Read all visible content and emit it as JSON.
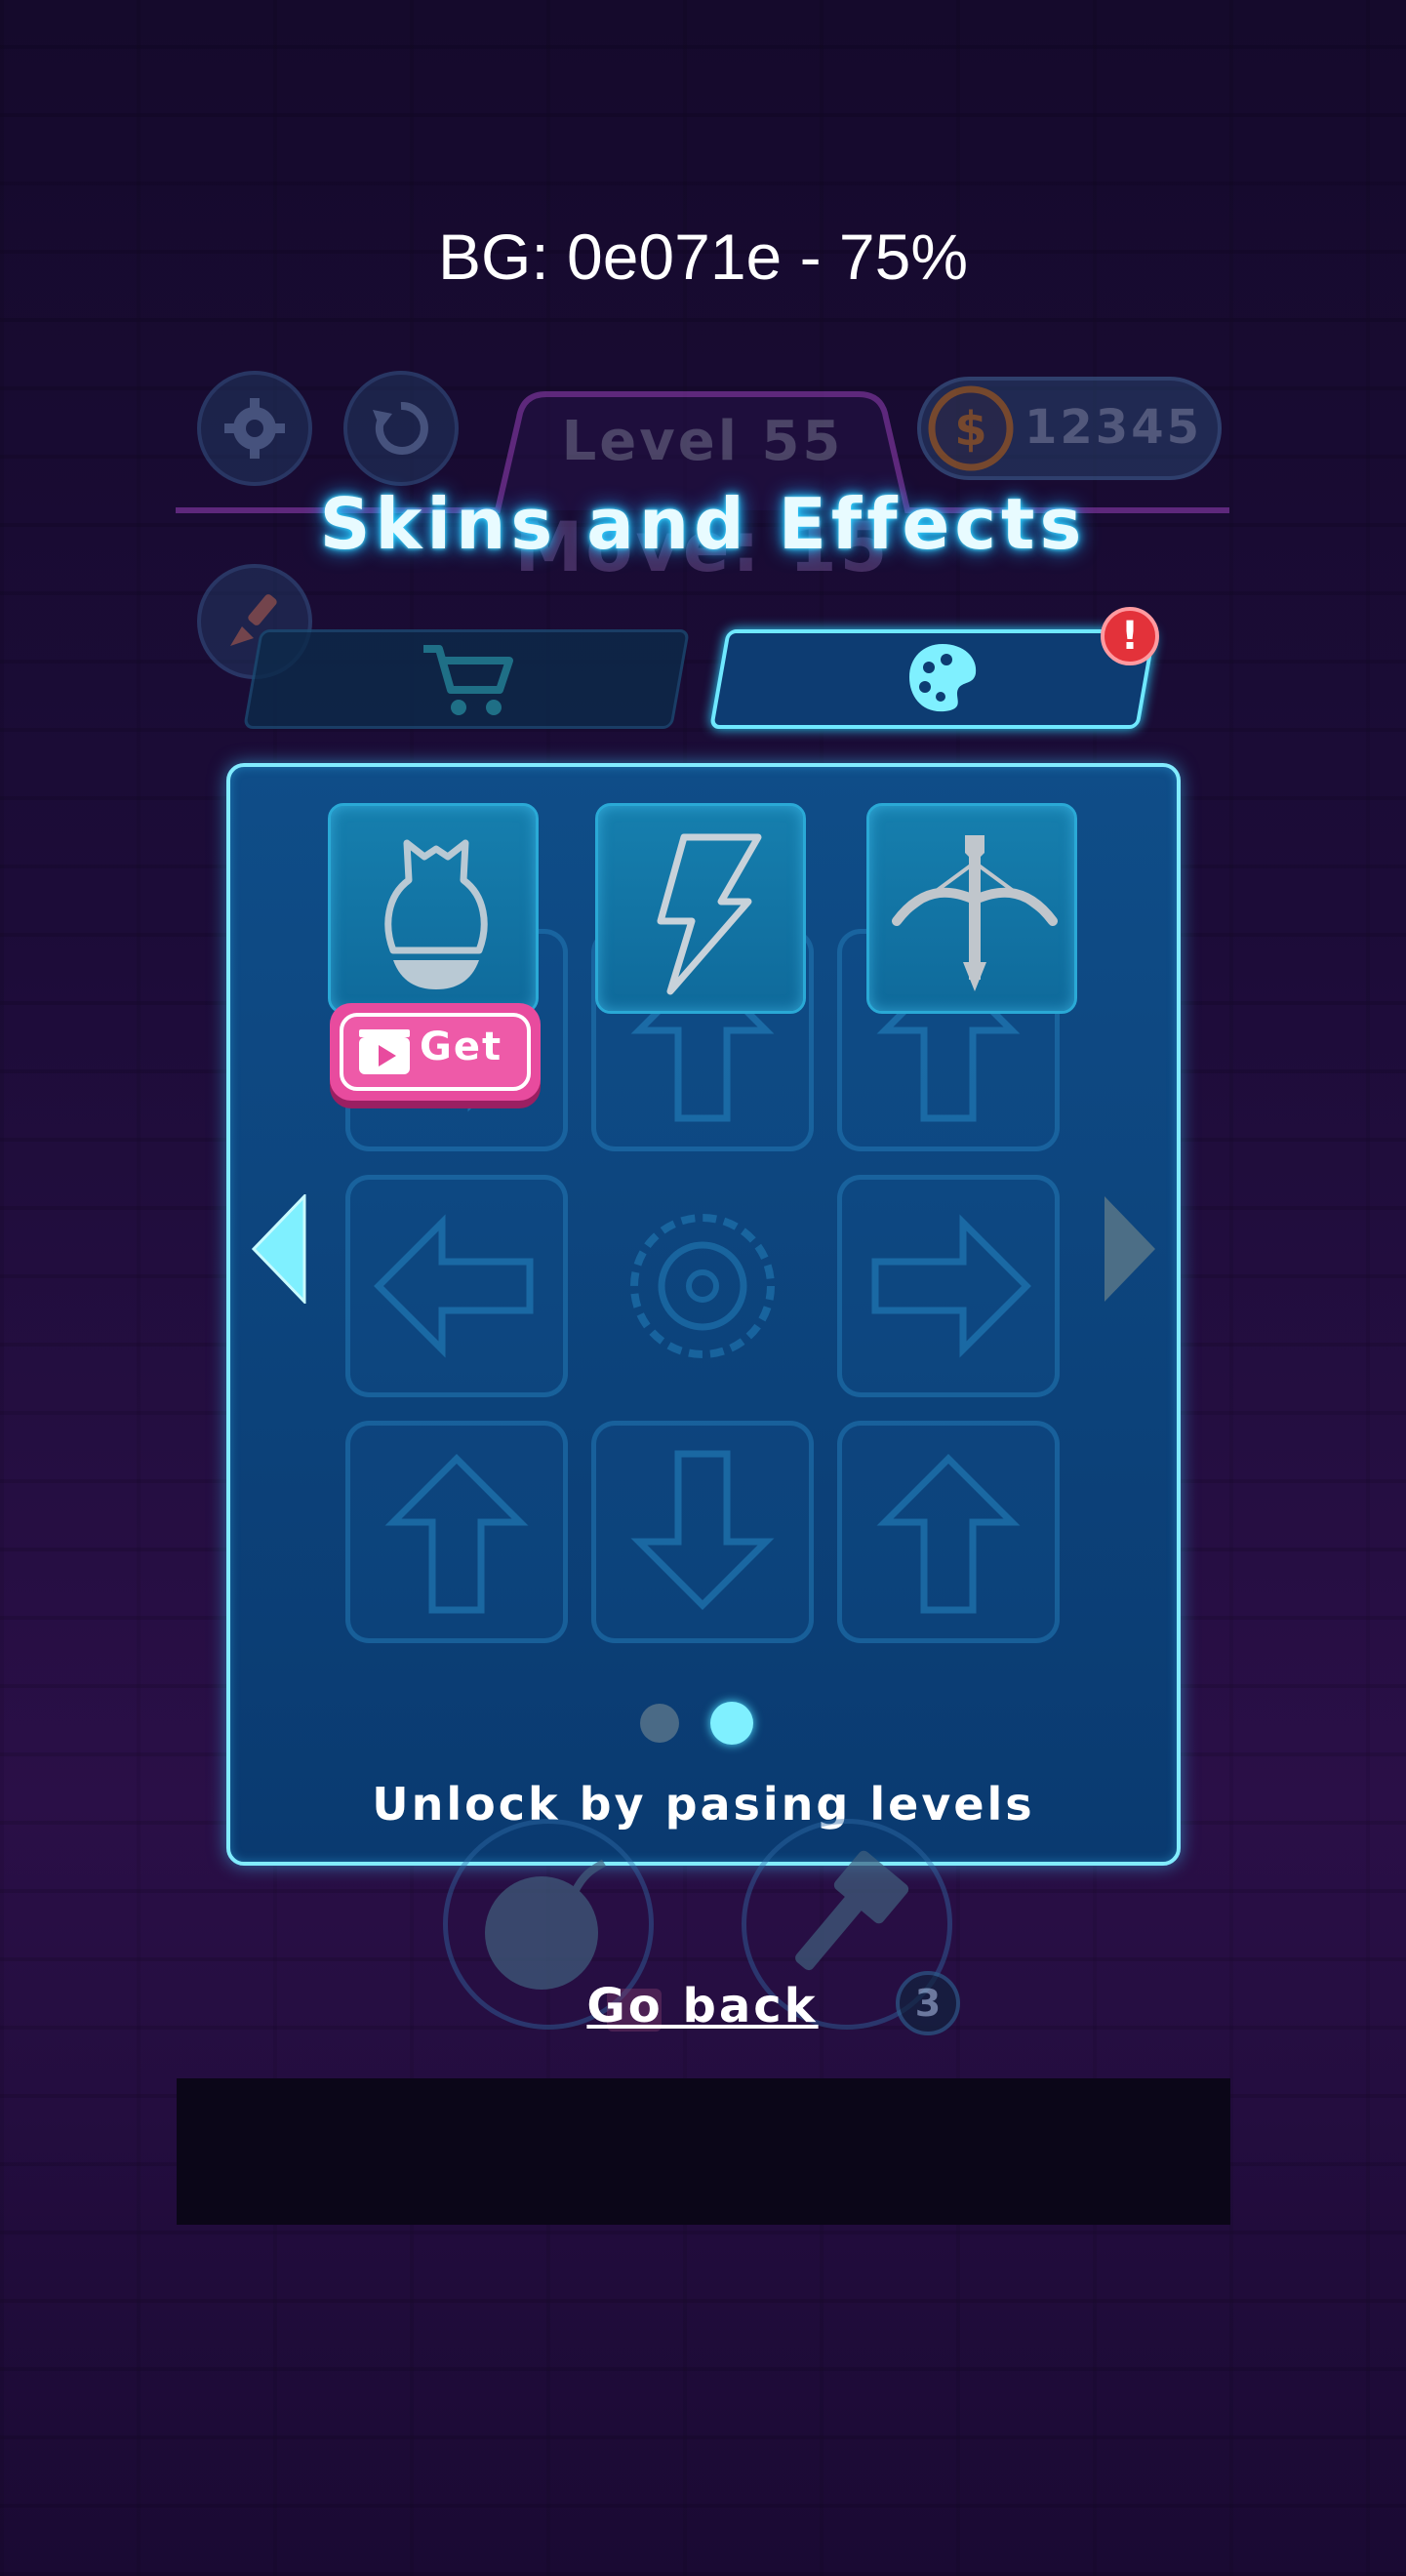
{
  "debug": {
    "bg_label": "BG: 0e071e  - 75%"
  },
  "hud": {
    "level_label": "Level 55",
    "move_label": "Move: 15",
    "coins": "12345"
  },
  "overlay": {
    "title": "Skins and Effects",
    "tabs": [
      {
        "name": "shop",
        "icon": "cart-icon",
        "active": false
      },
      {
        "name": "skins",
        "icon": "palette-icon",
        "active": true,
        "alert": "!"
      }
    ],
    "skins": [
      {
        "icon": "bomb-icon",
        "action": "Get"
      },
      {
        "icon": "lightning-icon"
      },
      {
        "icon": "crossbow-icon"
      }
    ],
    "page_dots": {
      "count": 2,
      "active": 1
    },
    "unlock_text": "Unlock by pasing levels",
    "go_back": "Go back",
    "hammer_count": "3"
  },
  "colors": {
    "background": "#0e071e",
    "panel": "#0f4d88",
    "panel_border": "#82ecff",
    "accent_cyan": "#7ff0ff",
    "get_button": "#e84b9e",
    "alert_badge": "#e3323a"
  }
}
